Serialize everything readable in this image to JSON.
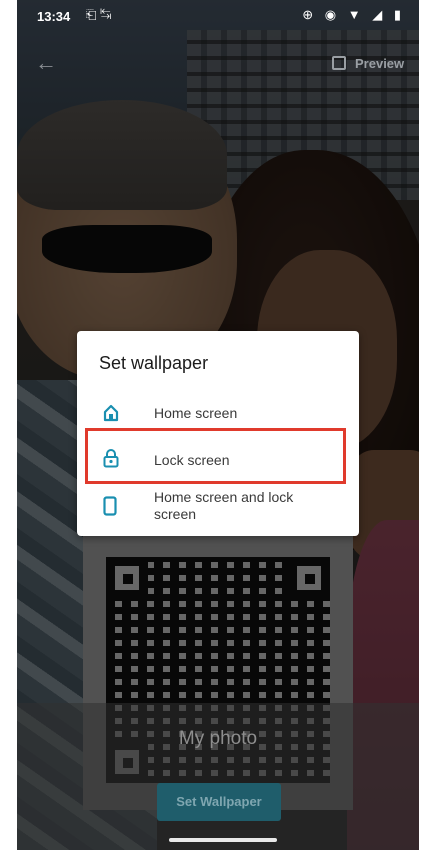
{
  "status_bar": {
    "time": "13:34",
    "left_icons": "⎗ ↹",
    "right_icons": "⊕ ◉ ▼ ◢ ▮"
  },
  "top_bar": {
    "preview_label": "Preview"
  },
  "dialog": {
    "title": "Set wallpaper",
    "options": [
      {
        "label": "Home screen",
        "icon": "home-icon"
      },
      {
        "label": "Lock screen",
        "icon": "lock-icon"
      },
      {
        "label": "Home screen and lock screen",
        "icon": "phone-icon"
      }
    ],
    "accent_color": "#1a8fb0",
    "highlight_color": "#e03a2c"
  },
  "bottom": {
    "title": "My photo",
    "button_label": "Set Wallpaper"
  }
}
